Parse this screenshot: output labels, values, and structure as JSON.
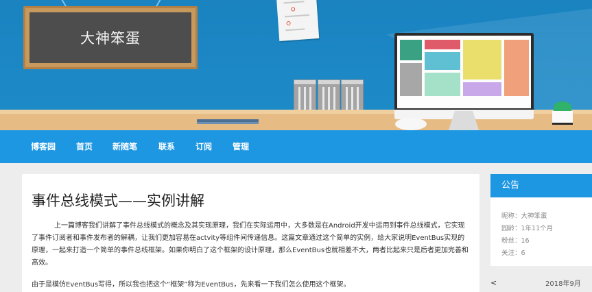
{
  "blog": {
    "title": "大神笨蛋"
  },
  "nav": {
    "items": [
      {
        "label": "博客园"
      },
      {
        "label": "首页"
      },
      {
        "label": "新随笔"
      },
      {
        "label": "联系"
      },
      {
        "label": "订阅"
      },
      {
        "label": "管理"
      }
    ]
  },
  "post": {
    "title": "事件总线模式——实例讲解",
    "paragraphs": [
      "上一篇博客我们讲解了事件总线模式的概念及其实现原理，我们在实际运用中，大多数是在Android开发中运用到事件总线模式，它实现了事件订阅者和事件发布者的解耦，让我们更加容易在actvity等组件间传递信息。这篇文章通过这个简单的实例，给大家说明EventBus实现的原理，一起来打造一个简单的事件总线框架。如果你明白了这个框架的设计原理，那么EventBus也就相差不大，两者比起来只是后者更加完善和高效。",
      "由于是模仿EventBus写得，所以我也把这个“框架”称为EventBus，先来看一下我们怎么使用这个框架。"
    ]
  },
  "sidebar": {
    "notice_title": "公告",
    "lines": [
      "昵称：大神笨蛋",
      "园龄：1年11个月",
      "粉丝：16",
      "关注：6"
    ],
    "calendar": {
      "prev": "<",
      "month": "2018年9月"
    }
  },
  "colors": {
    "nav_blue": "#1e97e3",
    "banner_blue": "#1b85c2",
    "desk": "#e7bc84",
    "board_frame": "#c7995d",
    "board_slate": "#4d4d4d"
  }
}
